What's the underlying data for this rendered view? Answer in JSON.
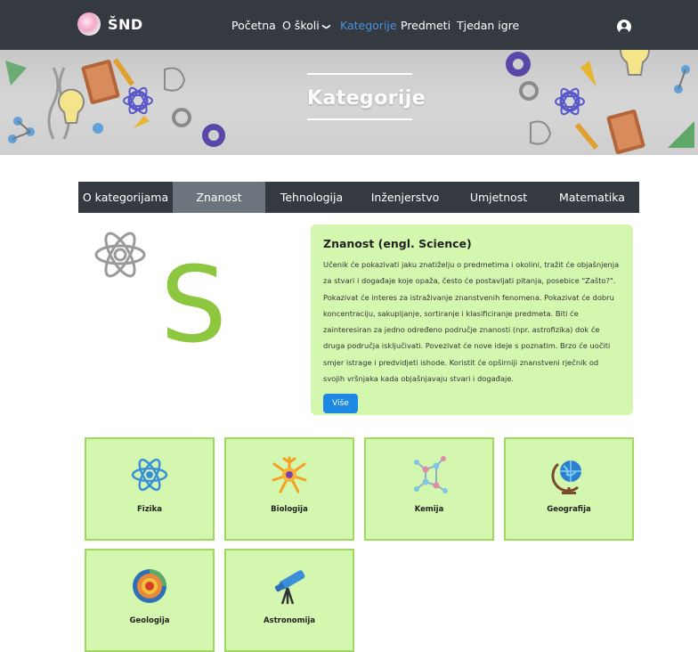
{
  "navbar": {
    "brand": "ŠND",
    "items": [
      {
        "label": "Početna"
      },
      {
        "label": "O školi",
        "caret": "❯"
      },
      {
        "label": "Kategorije"
      },
      {
        "label": "Predmeti"
      },
      {
        "label": "Tjedan igre"
      }
    ]
  },
  "hero": {
    "title": "Kategorije"
  },
  "tabs": [
    {
      "label": "O kategorijama"
    },
    {
      "label": "Znanost"
    },
    {
      "label": "Tehnologija"
    },
    {
      "label": "Inženjerstvo"
    },
    {
      "label": "Umjetnost"
    },
    {
      "label": "Matematika"
    }
  ],
  "featured": {
    "letter": "S",
    "title": "Znanost (engl. Science)",
    "text": "Učenik će pokazivati jaku znatiželju o predmetima i okolini, tražit će objašnjenja za stvari i događaje koje opaža, često će postavljati pitanja, posebice \"Zašto?\". Pokazivat će interes za istraživanje znanstvenih fenomena. Pokazivat će dobru koncentraciju, sakupljanje, sortiranje i klasificiranje predmeta. Biti će zainteresiran za jedno određeno područje znanosti (npr. astrofizika) dok će druga područja isključivati. Povezivat će nove ideje s poznatim. Brzo će uočiti smjer istrage i predvidjeti ishode. Koristit će opširniji znanstveni rječnik od svojih vršnjaka kada objašnjavaju stvari i događaje.",
    "button": "Više"
  },
  "subjects": [
    {
      "label": "Fizika",
      "icon": "atom-icon"
    },
    {
      "label": "Biologija",
      "icon": "neuron-icon"
    },
    {
      "label": "Kemija",
      "icon": "molecule-icon"
    },
    {
      "label": "Geografija",
      "icon": "globe-icon"
    },
    {
      "label": "Geologija",
      "icon": "earth-layers-icon"
    },
    {
      "label": "Astronomija",
      "icon": "telescope-icon"
    }
  ]
}
